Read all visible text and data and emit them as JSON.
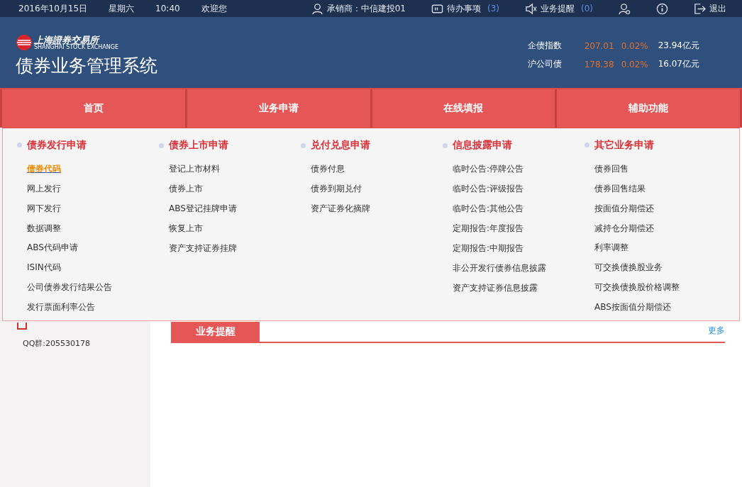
{
  "top_bar": {
    "date": "2016年10月15日",
    "weekday": "星期六",
    "time": "10:40",
    "greeting": "欢迎您",
    "items": [
      {
        "kind": "user",
        "label": "承销商：中信建投01"
      },
      {
        "kind": "todo",
        "label": "待办事项",
        "count": "(3)"
      },
      {
        "kind": "alert",
        "label": "业务提醒",
        "count": "(0)"
      },
      {
        "kind": "account"
      },
      {
        "kind": "info"
      },
      {
        "kind": "logout",
        "label": "退出"
      }
    ]
  },
  "header": {
    "logo_cn": "上海證券交易所",
    "logo_en": "SHANGHAI STOCK EXCHANGE",
    "title": "债券业务管理系统",
    "indices": [
      {
        "name": "企债指数",
        "value": "207.01",
        "change": "0.02%",
        "amount": "23.94亿元"
      },
      {
        "name": "沪公司债",
        "value": "178.38",
        "change": "0.02%",
        "amount": "16.07亿元"
      }
    ]
  },
  "nav": [
    {
      "label": "首页"
    },
    {
      "label": "业务申请"
    },
    {
      "label": "在线填报"
    },
    {
      "label": "辅助功能"
    }
  ],
  "dropdown": [
    {
      "title": "债券发行申请",
      "items": [
        {
          "label": "债券代码",
          "selected": true
        },
        {
          "label": "网上发行",
          "selected": false
        },
        {
          "label": "网下发行",
          "selected": false
        },
        {
          "label": "数据调整",
          "selected": false
        },
        {
          "label": "ABS代码申请",
          "selected": false
        },
        {
          "label": "ISIN代码",
          "selected": false
        },
        {
          "label": "公司债券发行结果公告",
          "selected": false
        },
        {
          "label": "发行票面利率公告",
          "selected": false
        }
      ]
    },
    {
      "title": "债券上市申请",
      "items": [
        {
          "label": "登记上市材料",
          "selected": false
        },
        {
          "label": "债券上市",
          "selected": false
        },
        {
          "label": "ABS登记挂牌申请",
          "selected": false
        },
        {
          "label": "恢复上市",
          "selected": false
        },
        {
          "label": "资产支持证券挂牌",
          "selected": false
        }
      ]
    },
    {
      "title": "兑付兑息申请",
      "items": [
        {
          "label": "债券付息",
          "selected": false
        },
        {
          "label": "债券到期兑付",
          "selected": false
        },
        {
          "label": "资产证券化摘牌",
          "selected": false
        }
      ]
    },
    {
      "title": "信息披露申请",
      "items": [
        {
          "label": "临时公告:停牌公告",
          "selected": false
        },
        {
          "label": "临时公告:评级报告",
          "selected": false
        },
        {
          "label": "临时公告:其他公告",
          "selected": false
        },
        {
          "label": "定期报告:年度报告",
          "selected": false
        },
        {
          "label": "定期报告:中期报告",
          "selected": false
        },
        {
          "label": "非公开发行债券信息披露",
          "selected": false
        },
        {
          "label": "资产支持证券信息披露",
          "selected": false
        }
      ]
    },
    {
      "title": "其它业务申请",
      "items": [
        {
          "label": "债券回售",
          "selected": false
        },
        {
          "label": "债券回售结果",
          "selected": false
        },
        {
          "label": "按面值分期偿还",
          "selected": false
        },
        {
          "label": "减持仓分期偿还",
          "selected": false
        },
        {
          "label": "利率调整",
          "selected": false
        },
        {
          "label": "可交换债换股业务",
          "selected": false
        },
        {
          "label": "可交换债换股价格调整",
          "selected": false
        },
        {
          "label": "ABS按面值分期偿还",
          "selected": false
        }
      ]
    }
  ],
  "sidebar": {
    "qq": "QQ群:205530178"
  },
  "panel": {
    "tab": "业务提醒",
    "more": "更多"
  }
}
